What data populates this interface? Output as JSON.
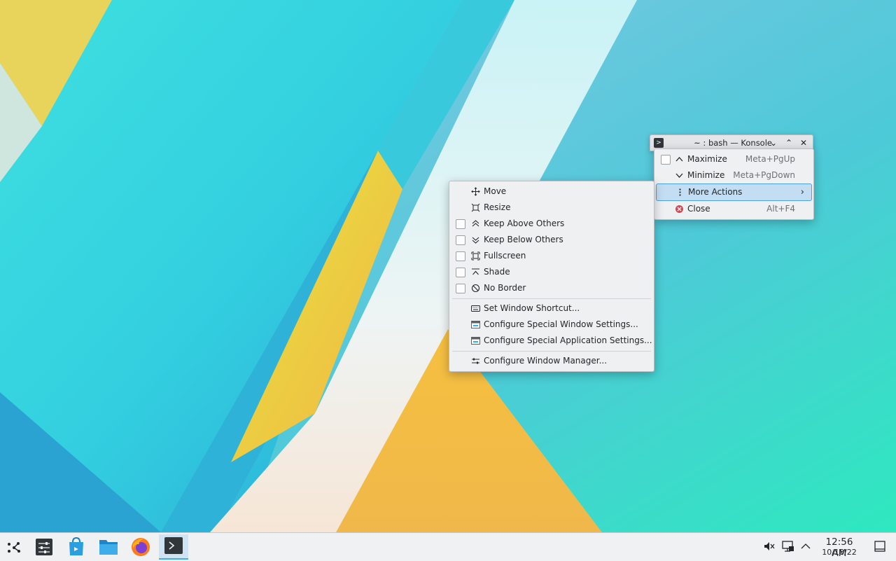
{
  "konsole": {
    "title": "~ : bash — Konsole",
    "buttons": {
      "menu": "⌄",
      "maximize": "⌃",
      "close": "✕"
    }
  },
  "window_menu": {
    "items": [
      {
        "label": "Maximize",
        "shortcut": "Meta+PgUp",
        "icon": "chevron-up-icon"
      },
      {
        "label": "Minimize",
        "shortcut": "Meta+PgDown",
        "icon": "chevron-down-icon"
      },
      {
        "label": "More Actions",
        "icon": "more-vertical-icon",
        "highlighted": true
      },
      {
        "label": "Close",
        "shortcut": "Alt+F4",
        "icon": "close-red-icon"
      }
    ]
  },
  "more_actions_menu": {
    "items": [
      {
        "label": "Move",
        "icon": "move-icon"
      },
      {
        "label": "Resize",
        "icon": "resize-icon"
      },
      {
        "label": "Keep Above Others",
        "icon": "keep-above-icon"
      },
      {
        "label": "Keep Below Others",
        "icon": "keep-below-icon"
      },
      {
        "label": "Fullscreen",
        "icon": "fullscreen-icon"
      },
      {
        "label": "Shade",
        "icon": "shade-icon"
      },
      {
        "label": "No Border",
        "icon": "no-border-icon"
      },
      {
        "label": "Set Window Shortcut...",
        "icon": "keyboard-icon"
      },
      {
        "label": "Configure Special Window Settings...",
        "icon": "window-settings-icon"
      },
      {
        "label": "Configure Special Application Settings...",
        "icon": "app-settings-icon"
      },
      {
        "label": "Configure Window Manager...",
        "icon": "sliders-icon"
      }
    ]
  },
  "taskbar": {
    "clock_time": "12:56 AM",
    "clock_date": "10/18/22",
    "apps": [
      "app-launcher-icon",
      "system-settings-icon",
      "discover-icon",
      "dolphin-icon",
      "firefox-icon",
      "konsole-icon"
    ]
  },
  "colors": {
    "accent": "#3daee9",
    "highlight_bg": "#c3ddf2",
    "close_red": "#da4453",
    "menu_bg": "#eff0f1"
  }
}
